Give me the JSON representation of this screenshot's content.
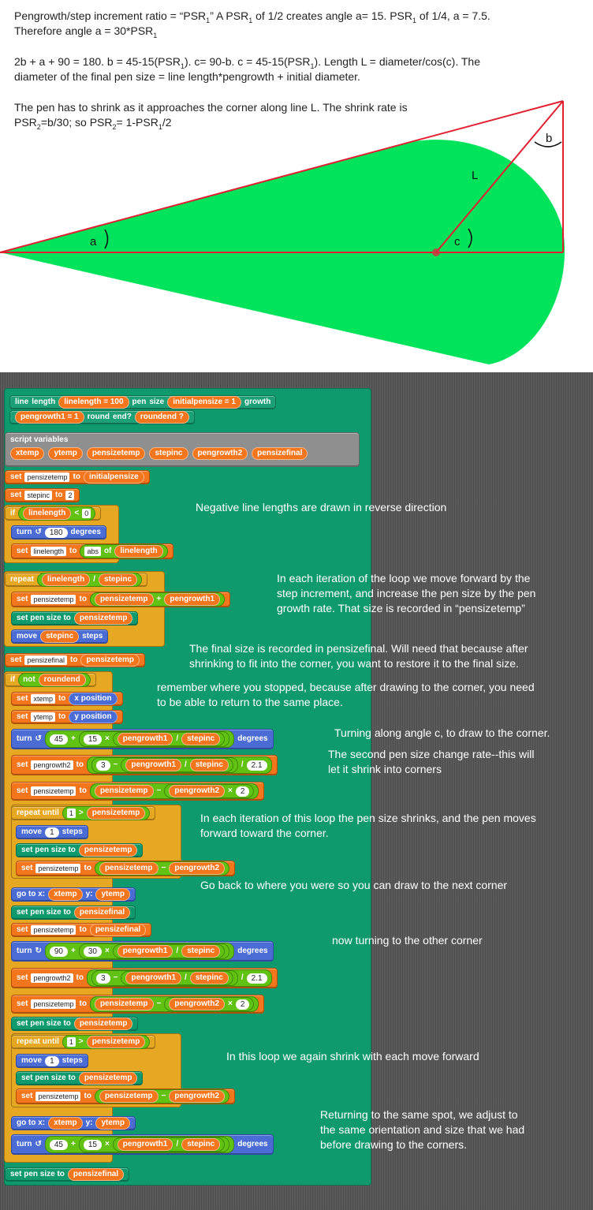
{
  "notes": {
    "l1a": "Pengrowth/step increment ratio = “PSR",
    "l1b": "” A PSR",
    "l1c": " of 1/2 creates angle a= 15. PSR",
    "l1d": " of 1/4, a = 7.5.",
    "l2a": "Therefore angle a = 30*PSR",
    "l3a": "2b + a + 90 = 180. b = 45-15(PSR",
    "l3b": ").  c= 90-b. c = 45-15(PSR",
    "l3c": "). Length L = diameter/cos(c). The",
    "l4": "diameter of the final pen size = line length*pengrowth + initial diameter.",
    "l5": "The pen has to shrink as it approaches the corner along line L. The shrink rate is",
    "l6a": "PSR",
    "l6b": "=b/30; so PSR",
    "l6c": "= 1-PSR",
    "l6d": "/2",
    "s1": "1",
    "s2": "2"
  },
  "diagram": {
    "label_a": "a",
    "label_b": "b",
    "label_c": "c",
    "label_L": "L",
    "fill_color": "#00e35a",
    "line_color": "#e02030"
  },
  "annotations": [
    "Negative line lengths are drawn in reverse direction",
    "In each iteration of the loop we move forward by the",
    "step increment, and increase the pen size by the pen",
    "growth rate. That size is recorded in “pensizetemp”",
    "The final size is recorded in pensizefinal. Will need that because after",
    "shrinking to fit into the corner, you want to restore it to the final size.",
    "remember where you stopped, because after drawing to the corner, you need",
    "to be able to return to the same place.",
    "Turning along angle c, to draw to the corner.",
    "The second pen size change rate--this will",
    "let it shrink into corners",
    "In each iteration of this loop the pen size shrinks, and the pen moves",
    "forward toward the corner.",
    "Go back to where you were so you can draw to the next corner",
    "now turning to the other corner",
    "In this loop we again shrink with each move forward",
    "Returning to the same spot, we adjust to",
    "the same orientation and size that we had",
    "before drawing to the corners."
  ],
  "blocks": {
    "hat": {
      "line": "line",
      "length": "length",
      "linelength_default": "linelength = 100",
      "pen": "pen",
      "size": "size",
      "initialpensize_default": "initialpensize = 1",
      "growth": "growth",
      "pengrowth1_default": "pengrowth1 = 1",
      "round": "round",
      "end": "end?",
      "roundend_default": "roundend ?"
    },
    "script_vars": {
      "label": "script variables",
      "vars": [
        "xtemp",
        "ytemp",
        "pensizetemp",
        "stepinc",
        "pengrowth2",
        "pensizefinal"
      ]
    },
    "kw": {
      "set": "set",
      "to": "to",
      "if": "if",
      "turn": "turn",
      "degrees": "degrees",
      "of": "of",
      "repeat": "repeat",
      "repeat_until": "repeat until",
      "move": "move",
      "steps": "steps",
      "set_pen_size_to": "set pen size to",
      "go_to_x": "go to x:",
      "y": "y:",
      "not": "not",
      "x_position": "x position",
      "y_position": "y position",
      "abs": "abs",
      "lt": "<",
      "gt": ">",
      "plus": "+",
      "minus": "−",
      "div": "/",
      "times": "×"
    },
    "v": {
      "pensizetemp": "pensizetemp",
      "stepinc": "stepinc",
      "linelength": "linelength",
      "pensizefinal": "pensizefinal",
      "xtemp": "xtemp",
      "ytemp": "ytemp",
      "pengrowth2": "pengrowth2",
      "initialpensize": "initialpensize",
      "pengrowth1": "pengrowth1",
      "roundend": "roundend"
    },
    "n": {
      "n2": "2",
      "n0": "0",
      "n180": "180",
      "n45": "45",
      "n15": "15",
      "n3": "3",
      "n2_1": "2.1",
      "n1": "1",
      "n90": "90",
      "n30": "30"
    }
  }
}
